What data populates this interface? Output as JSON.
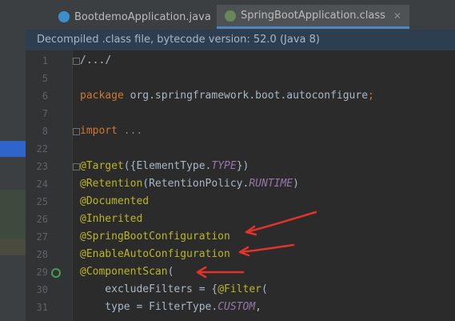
{
  "tabs": [
    {
      "label": "BootdemoApplication.java",
      "active": false
    },
    {
      "label": "SpringBootApplication.class",
      "active": true
    }
  ],
  "banner": "Decompiled .class file, bytecode version: 52.0 (Java 8)",
  "lines": [
    {
      "num": "1",
      "tokens": [
        {
          "t": "/...",
          "c": "plain"
        },
        {
          "t": "/",
          "c": "plain"
        }
      ]
    },
    {
      "num": "5",
      "tokens": []
    },
    {
      "num": "6",
      "tokens": [
        {
          "t": "package ",
          "c": "kw"
        },
        {
          "t": "org.springframework.boot.autoconfigure",
          "c": "plain"
        },
        {
          "t": ";",
          "c": "kw"
        }
      ]
    },
    {
      "num": "7",
      "tokens": []
    },
    {
      "num": "8",
      "tokens": [
        {
          "t": "import ",
          "c": "kw"
        },
        {
          "t": "...",
          "c": "gray"
        }
      ]
    },
    {
      "num": "22",
      "tokens": []
    },
    {
      "num": "23",
      "tokens": [
        {
          "t": "@Target",
          "c": "ann"
        },
        {
          "t": "({ElementType.",
          "c": "plain"
        },
        {
          "t": "TYPE",
          "c": "it"
        },
        {
          "t": "})",
          "c": "plain"
        }
      ]
    },
    {
      "num": "24",
      "tokens": [
        {
          "t": "@Retention",
          "c": "ann"
        },
        {
          "t": "(RetentionPolicy.",
          "c": "plain"
        },
        {
          "t": "RUNTIME",
          "c": "it"
        },
        {
          "t": ")",
          "c": "plain"
        }
      ]
    },
    {
      "num": "25",
      "tokens": [
        {
          "t": "@Documented",
          "c": "ann"
        }
      ]
    },
    {
      "num": "26",
      "tokens": [
        {
          "t": "@Inherited",
          "c": "ann"
        }
      ]
    },
    {
      "num": "27",
      "tokens": [
        {
          "t": "@SpringBootConfiguration",
          "c": "ann"
        }
      ]
    },
    {
      "num": "28",
      "tokens": [
        {
          "t": "@EnableAutoConfiguration",
          "c": "ann"
        }
      ]
    },
    {
      "num": "29",
      "tokens": [
        {
          "t": "@ComponentScan",
          "c": "ann"
        },
        {
          "t": "(",
          "c": "plain"
        }
      ]
    },
    {
      "num": "30",
      "tokens": [
        {
          "t": "    excludeFilters = {",
          "c": "plain"
        },
        {
          "t": "@Filter",
          "c": "ann"
        },
        {
          "t": "(",
          "c": "plain"
        }
      ]
    },
    {
      "num": "31",
      "tokens": [
        {
          "t": "    type = FilterType.",
          "c": "plain"
        },
        {
          "t": "CUSTOM",
          "c": "it"
        },
        {
          "t": ",",
          "c": "plain"
        }
      ]
    }
  ],
  "colors": {
    "arrow": "#e0342a",
    "annotation": "#bbb529",
    "keyword": "#cc7832"
  }
}
